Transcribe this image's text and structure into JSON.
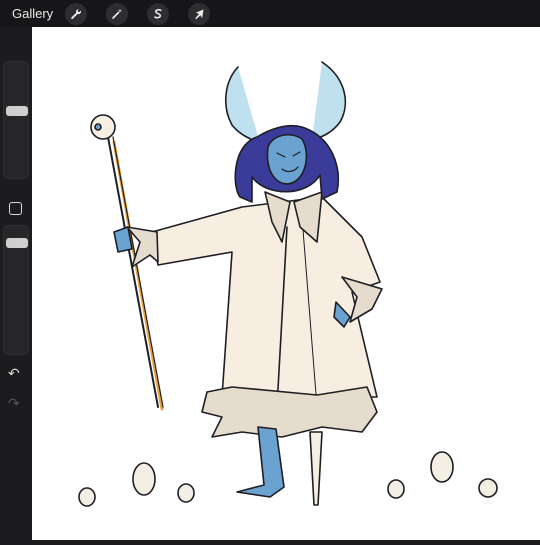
{
  "topbar": {
    "gallery_label": "Gallery",
    "tools": [
      {
        "name": "wrench-icon",
        "action": "actions"
      },
      {
        "name": "magic-wand-icon",
        "action": "adjustments"
      },
      {
        "name": "selection-s-icon",
        "action": "selection"
      },
      {
        "name": "arrow-cursor-icon",
        "action": "transform"
      }
    ]
  },
  "sidebar": {
    "brush_size_level": 0.65,
    "opacity_level": 0.9,
    "icons": [
      "square-modifier-icon",
      "undo-icon",
      "redo-icon"
    ]
  },
  "canvas": {
    "subject": "drawing",
    "colors": {
      "skin": "#6aa3d0",
      "hair": "#3b3c9a",
      "coat": "#f7eee1",
      "fur": "#e5dccd",
      "line": "#1e1e24",
      "staff_shadow": "#e7a43c"
    }
  }
}
